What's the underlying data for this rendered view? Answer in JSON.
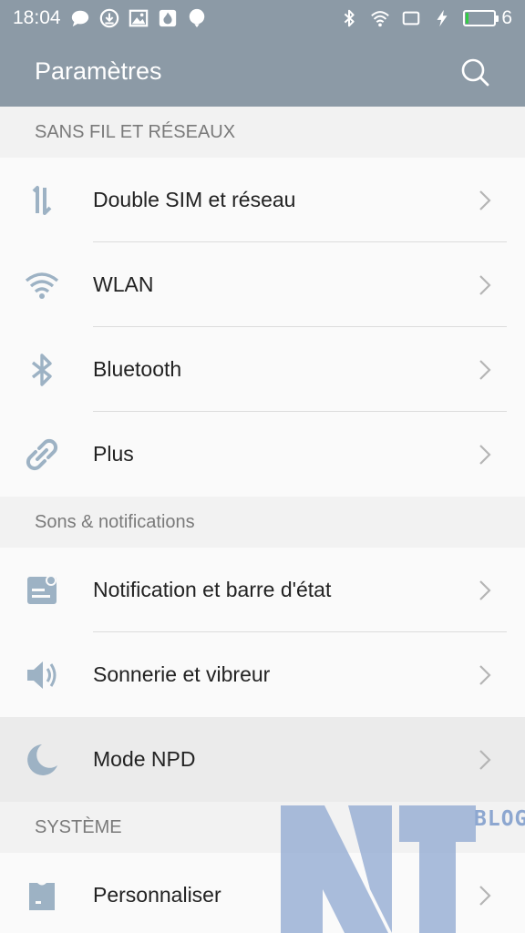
{
  "statusbar": {
    "time": "18:04",
    "battery_level": "6",
    "battery_fill_pct": 6,
    "left_icons": [
      "message-icon",
      "download-icon",
      "image-icon",
      "fire-icon",
      "balloon-icon"
    ],
    "right_icons": [
      "bluetooth-icon",
      "wifi-icon",
      "screen-icon",
      "charging-icon"
    ]
  },
  "appbar": {
    "title": "Paramètres",
    "search_icon": "search-icon"
  },
  "sections": [
    {
      "header": "SANS FIL ET RÉSEAUX",
      "items": [
        {
          "label": "Double SIM et réseau",
          "icon": "dual-sim-icon"
        },
        {
          "label": "WLAN",
          "icon": "wifi-icon"
        },
        {
          "label": "Bluetooth",
          "icon": "bluetooth-icon"
        },
        {
          "label": "Plus",
          "icon": "link-icon"
        }
      ]
    },
    {
      "header": "Sons & notifications",
      "items": [
        {
          "label": "Notification et barre d'état",
          "icon": "notification-icon"
        },
        {
          "label": "Sonnerie et vibreur",
          "icon": "speaker-icon"
        },
        {
          "label": "Mode NPD",
          "icon": "moon-icon"
        }
      ]
    },
    {
      "header": "SYSTÈME",
      "items": [
        {
          "label": "Personnaliser",
          "icon": "personalize-icon"
        }
      ]
    }
  ],
  "watermark": {
    "text": "BLOG"
  },
  "colors": {
    "appbar": "#8c9aa6",
    "icon": "#9db2c4",
    "battery": "#33cc44"
  }
}
